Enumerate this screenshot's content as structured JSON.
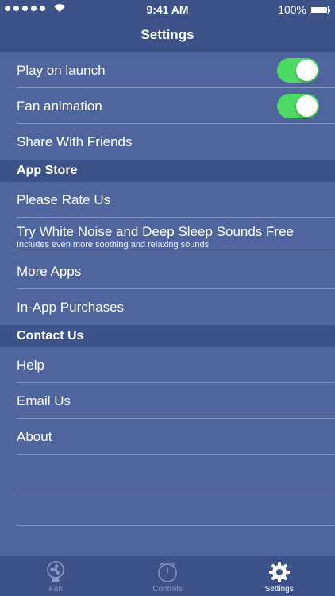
{
  "status_bar": {
    "time": "9:41 AM",
    "battery": "100%"
  },
  "nav": {
    "title": "Settings"
  },
  "rows_general": [
    {
      "label": "Play on launch",
      "toggle": true
    },
    {
      "label": "Fan animation",
      "toggle": true
    },
    {
      "label": "Share With Friends"
    }
  ],
  "section_app_store": {
    "title": "App Store"
  },
  "rows_app_store": {
    "rate": "Please Rate Us",
    "white_noise": "Try White Noise and Deep Sleep Sounds Free",
    "white_noise_sub": "Includes even more soothing and relaxing sounds",
    "more_apps": "More Apps",
    "purchases": "In-App Purchases"
  },
  "section_contact": {
    "title": "Contact Us"
  },
  "rows_contact": {
    "help": "Help",
    "email": "Email Us",
    "about": "About"
  },
  "tab_bar": {
    "fan": "Fan",
    "controls": "Controls",
    "settings": "Settings"
  },
  "colors": {
    "background": "#50649e",
    "header": "#3e528a",
    "toggle_on": "#4cd964"
  }
}
